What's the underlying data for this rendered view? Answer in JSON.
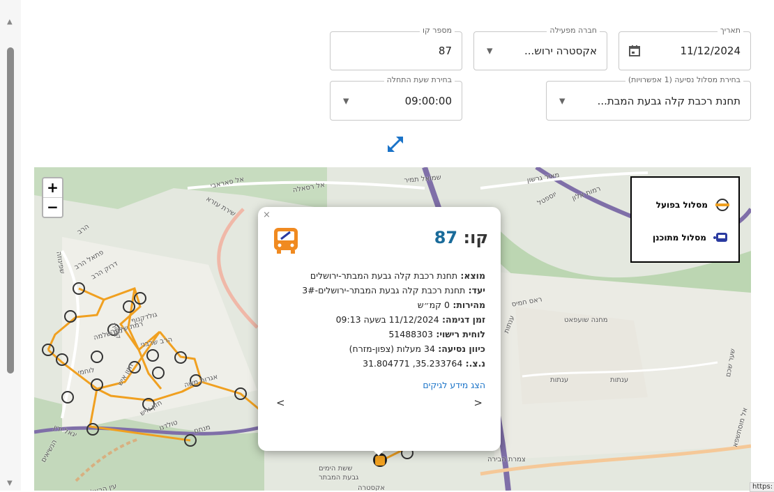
{
  "form": {
    "date": {
      "legend": "תאריך",
      "value": "11/12/2024"
    },
    "operator": {
      "legend": "חברה מפעילה",
      "value": "אקסטרה ירוש..."
    },
    "line": {
      "legend": "מספר קו",
      "value": "87"
    },
    "route": {
      "legend": "בחירת מסלול נסיעה (1 אפשרויות)",
      "value": "תחנת רכבת קלה גבעת המבת..."
    },
    "start_time": {
      "legend": "בחירת שעת התחלה",
      "value": "09:00:00"
    }
  },
  "map": {
    "zoom_in": "+",
    "zoom_out": "−",
    "legend": {
      "actual": "מסלול בפועל",
      "planned": "מסלול מתוכנן"
    },
    "labels": [
      "אל פאראבי",
      "אל רסאלה",
      "שמואל תמיר",
      "מאיר גרשון",
      "רמות אלון",
      "יוספטל",
      "שירת עזרא",
      "הרב",
      "שפינוזה",
      "פתאל הרב",
      "דרוק הרב",
      "קריית",
      "גולדקנוף",
      "רמת שלמה",
      "הרב שרבני",
      "חזון איש",
      "לוחמי",
      "אגרות משה",
      "חזון איש",
      "טולדנו",
      "יגאל ידין",
      "מנחם",
      "הנשיאים",
      "ששת הימים",
      "גבעת המבתר",
      "אקסטרה",
      "עין הרצל",
      "ראס חמיס",
      "מחנה שועפאט",
      "ענתות",
      "ענתות",
      "ענתות",
      "צמרת הבירה",
      "שער שכם",
      "אל מוסתשפא",
      "רמת שלמה"
    ],
    "colors": {
      "route": "#f0a020",
      "stop": "#444444",
      "road_main": "#f5c898",
      "water": "#7f6fa8"
    }
  },
  "popup": {
    "close": "×",
    "title_prefix": "קו:",
    "line_number": "87",
    "rows": [
      {
        "label": "מוצא:",
        "value": "תחנת רכבת קלה גבעת המבתר-ירושלים"
      },
      {
        "label": "יעד:",
        "value": "תחנת רכבת קלה גבעת המבתר-ירושלים-3#"
      },
      {
        "label": "מהירות:",
        "value": "0 קמ״ש"
      },
      {
        "label": "זמן דגימה:",
        "value": "11/12/2024 בשעה 09:13"
      },
      {
        "label": "לוחית רישוי:",
        "value": "51488303"
      },
      {
        "label": "כיוון נסיעה:",
        "value": "34 מעלות (צפון-מזרח)"
      },
      {
        "label": "נ.צ.:",
        "value": "35.233764, 31.804771"
      }
    ],
    "link": "הצג מידע לגיקים",
    "prev": "<",
    "next": ">"
  },
  "url_hint": "https:"
}
